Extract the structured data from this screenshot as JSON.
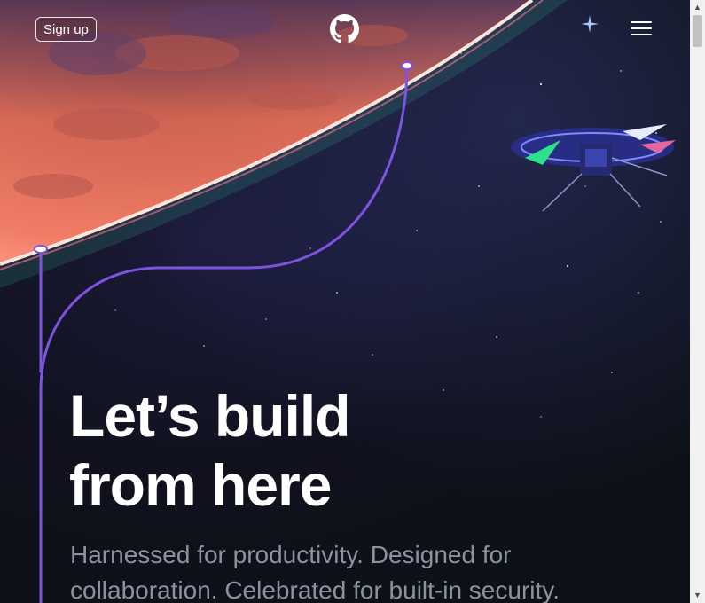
{
  "header": {
    "signup_label": "Sign up",
    "logo_icon": "github-mark-icon",
    "menu_icon": "hamburger-menu-icon"
  },
  "hero": {
    "headline_line1": "Let’s build",
    "headline_line2": "from here",
    "subtitle": "Harnessed for productivity. Designed for collaboration. Celebrated for built-in security."
  },
  "colors": {
    "background": "#0d1117",
    "planet": "#e0715c",
    "path_line": "#7c54e0",
    "headline": "#ffffff",
    "subtitle": "#8b949e"
  }
}
